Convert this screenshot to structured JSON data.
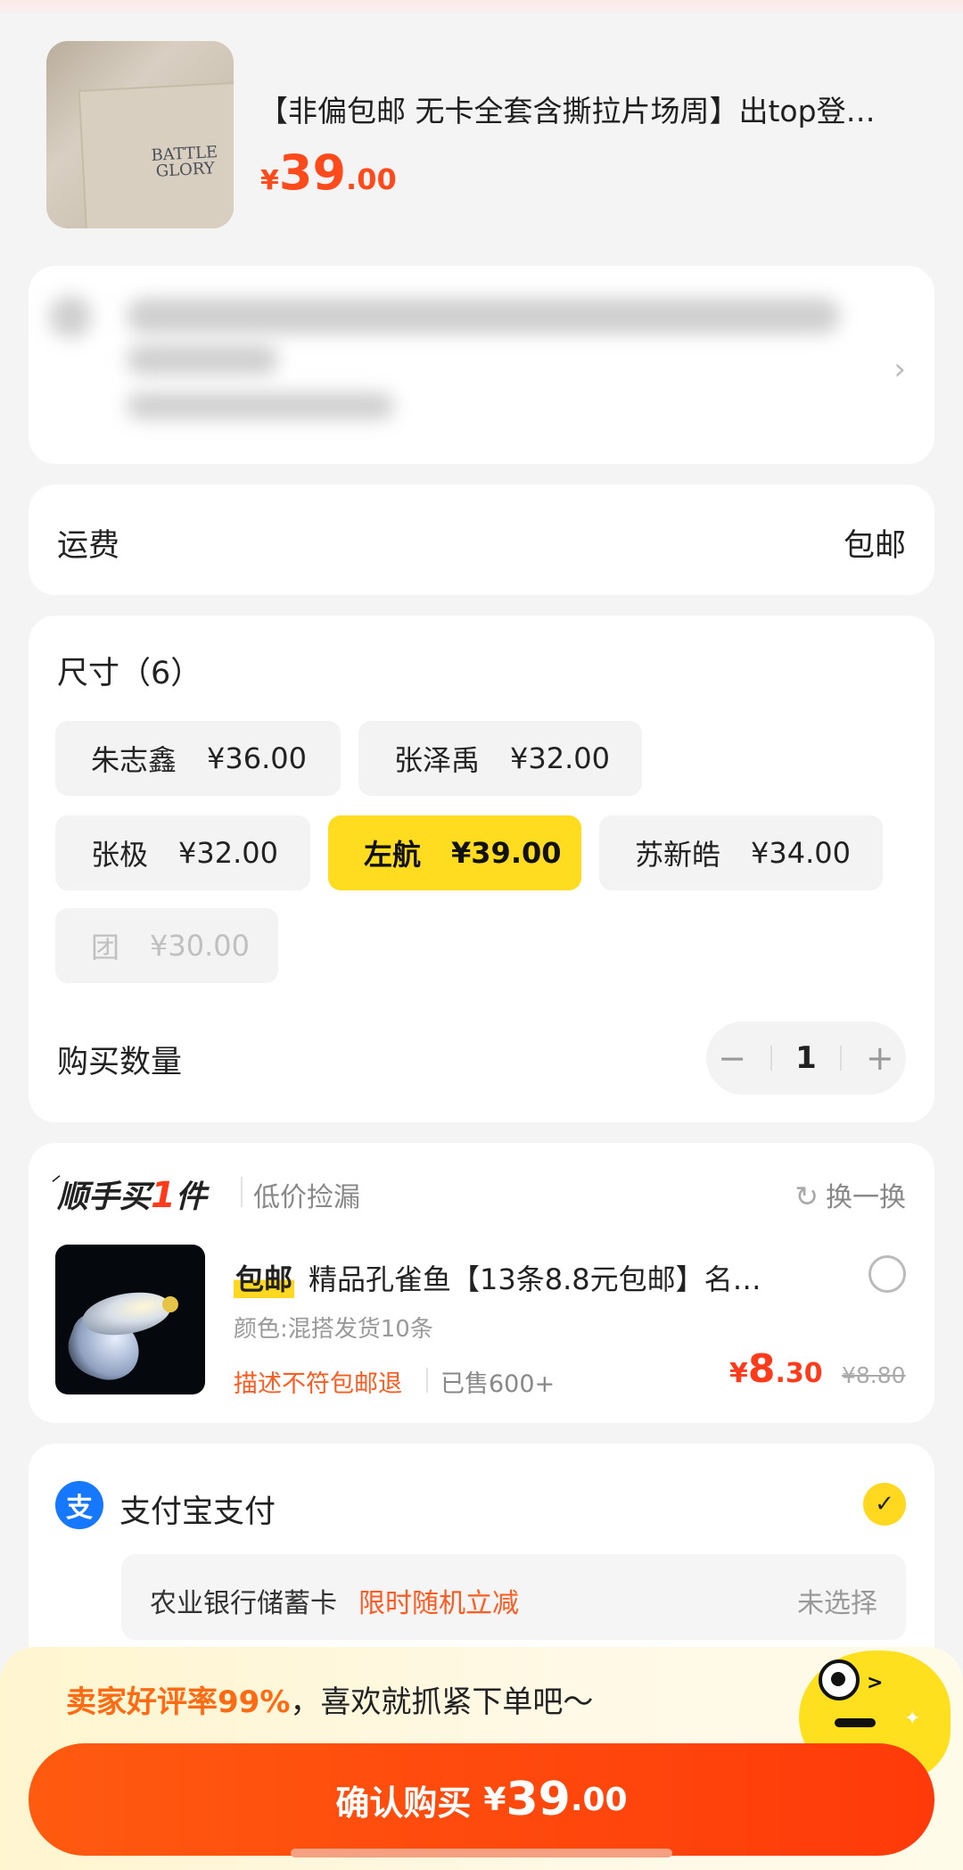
{
  "product": {
    "title": "【非偏包邮 无卡全套含撕拉片场周】出top登…",
    "price_currency": "¥",
    "price_int": "39",
    "price_dec": ".00",
    "image_text": "BATTLE\nGLORY"
  },
  "shipping": {
    "label": "运费",
    "value": "包邮"
  },
  "sizes": {
    "header": "尺寸（6）",
    "options": [
      {
        "name": "朱志鑫",
        "price": "¥36.00",
        "state": "normal"
      },
      {
        "name": "张泽禹",
        "price": "¥32.00",
        "state": "normal"
      },
      {
        "name": "张极",
        "price": "¥32.00",
        "state": "normal"
      },
      {
        "name": "左航",
        "price": "¥39.00",
        "state": "selected"
      },
      {
        "name": "苏新皓",
        "price": "¥34.00",
        "state": "normal"
      },
      {
        "name": "团",
        "price": "¥30.00",
        "state": "disabled"
      }
    ],
    "quantity_label": "购买数量",
    "quantity": "1",
    "minus": "−",
    "plus": "+"
  },
  "addon": {
    "title_pre": "顺手买",
    "title_num": "1",
    "title_post": "件",
    "subtitle": "低价捡漏",
    "swap": "换一换",
    "badge": "包邮",
    "name": "精品孔雀鱼【13条8.8元包邮】名…",
    "spec": "颜色:混搭发货10条",
    "tag": "描述不符包邮退",
    "sold": "已售600+",
    "price_currency": "¥",
    "price_int": "8",
    "price_dec": ".30",
    "old_price": "¥8.80"
  },
  "payment": {
    "method": "支付宝支付",
    "icon_text": "支",
    "card": "农业银行储蓄卡",
    "promo": "限时随机立减",
    "unselected": "未选择"
  },
  "promo": {
    "highlight": "卖家好评率99%",
    "text": "，喜欢就抓紧下单吧～"
  },
  "confirm": {
    "label": "确认购买",
    "currency": "¥",
    "int": "39",
    "dec": ".00"
  },
  "colors": {
    "accent": "#ff4a1c",
    "selected": "#ffdc1f",
    "alipay": "#1677ff"
  }
}
